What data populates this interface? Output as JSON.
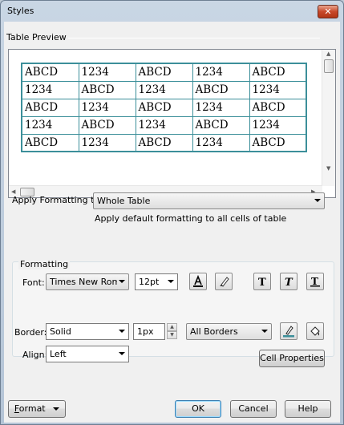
{
  "window": {
    "title": "Styles",
    "close_glyph": "✕"
  },
  "preview": {
    "section_label": "Table Preview",
    "rows": [
      [
        "ABCD",
        "1234",
        "ABCD",
        "1234",
        "ABCD"
      ],
      [
        "1234",
        "ABCD",
        "1234",
        "ABCD",
        "1234"
      ],
      [
        "ABCD",
        "1234",
        "ABCD",
        "1234",
        "ABCD"
      ],
      [
        "1234",
        "ABCD",
        "1234",
        "ABCD",
        "1234"
      ],
      [
        "ABCD",
        "1234",
        "ABCD",
        "1234",
        "ABCD"
      ]
    ],
    "border_color": "#3c8f9a"
  },
  "apply": {
    "label": "Apply Formatting to:",
    "value": "Whole Table",
    "description": "Apply default formatting to all cells of table"
  },
  "formatting": {
    "group_label": "Formatting",
    "font_label": "Font:",
    "font_value": "Times New Roma",
    "size_value": "12pt",
    "border_label": "Border:",
    "border_style": "Solid",
    "border_width": "1px",
    "borders_value": "All Borders",
    "align_label": "Align:",
    "align_value": "Left",
    "cell_properties_label": "Cell Properties",
    "icons": [
      "font-color-icon",
      "highlight-icon",
      "bold-icon",
      "italic-icon",
      "underline-icon",
      "border-color-icon",
      "fill-color-icon"
    ]
  },
  "buttons": {
    "format_f": "F",
    "format_rest": "ormat",
    "ok": "OK",
    "cancel": "Cancel",
    "help": "Help"
  },
  "colors": {
    "accent": "#3c7fb1",
    "close": "#c7482a"
  }
}
